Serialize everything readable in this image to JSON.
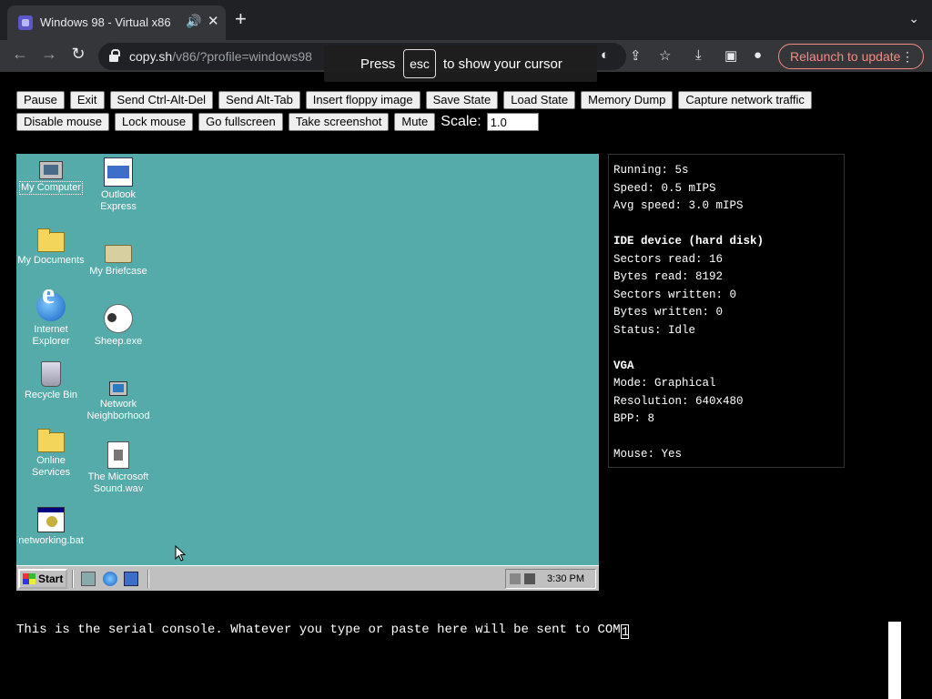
{
  "browser": {
    "tab_title": "Windows 98 - Virtual x86",
    "url_host": "copy.sh",
    "url_path": "/v86/?profile=windows98",
    "relaunch_label": "Relaunch to update"
  },
  "esc_hint": {
    "before": "Press",
    "key": "esc",
    "after": "to show your cursor"
  },
  "controls": {
    "row1": [
      "Pause",
      "Exit",
      "Send Ctrl-Alt-Del",
      "Send Alt-Tab",
      "Insert floppy image",
      "Save State",
      "Load State",
      "Memory Dump",
      "Capture network traffic"
    ],
    "row2": [
      "Disable mouse",
      "Lock mouse",
      "Go fullscreen",
      "Take screenshot",
      "Mute"
    ],
    "scale_label": "Scale:",
    "scale_value": "1.0"
  },
  "desktop": {
    "icons": [
      {
        "label": "My Computer",
        "icon": "computer-icon"
      },
      {
        "label": "My Documents",
        "icon": "folder-icon"
      },
      {
        "label": "Internet Explorer",
        "icon": "internet-explorer-icon"
      },
      {
        "label": "Recycle Bin",
        "icon": "recycle-bin-icon"
      },
      {
        "label": "Online Services",
        "icon": "folder-icon"
      },
      {
        "label": "networking.bat",
        "icon": "batch-file-icon"
      },
      {
        "label": "Outlook Express",
        "icon": "outlook-express-icon"
      },
      {
        "label": "My Briefcase",
        "icon": "briefcase-icon"
      },
      {
        "label": "Sheep.exe",
        "icon": "sheep-icon"
      },
      {
        "label": "Network Neighborhood",
        "icon": "network-icon"
      },
      {
        "label": "The Microsoft Sound.wav",
        "icon": "sound-file-icon"
      }
    ],
    "taskbar": {
      "start_label": "Start",
      "clock": "3:30 PM"
    }
  },
  "stats": {
    "running": "Running: 5s",
    "speed": "Speed: 0.5 mIPS",
    "avg_speed": "Avg speed: 3.0 mIPS",
    "ide_header": "IDE device (hard disk)",
    "sectors_read": "Sectors read: 16",
    "bytes_read": "Bytes read: 8192",
    "sectors_written": "Sectors written: 0",
    "bytes_written": "Bytes written: 0",
    "status": "Status: Idle",
    "vga_header": "VGA",
    "mode": "Mode: Graphical",
    "resolution": "Resolution: 640x480",
    "bpp": "BPP: 8",
    "mouse": "Mouse: Yes"
  },
  "serial": {
    "text": "This is the serial console. Whatever you type or paste here will be sent to COM",
    "caret_char": "1"
  }
}
